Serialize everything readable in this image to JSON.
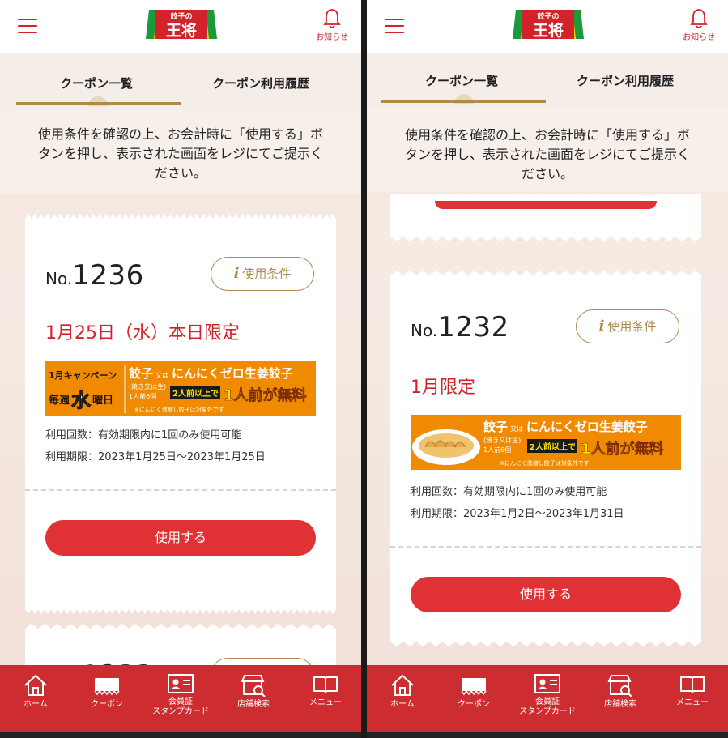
{
  "screens": [
    {
      "header": {
        "logo_top": "餃子の",
        "logo_main": "王将",
        "notify_label": "お知らせ"
      },
      "tabs": [
        {
          "label": "クーポン一覧"
        },
        {
          "label": "クーポン利用履歴"
        }
      ],
      "notice": [
        "使用条件を確認の上、お会計時に「使用する」ボ",
        "タンを押し、表示された画面をレジにてご提示く",
        "ださい。"
      ],
      "coupon": {
        "no_prefix": "No.",
        "number": "1236",
        "conditions_label": "使用条件",
        "deadline": "1月25日（水）本日限定",
        "banner": {
          "campaign": "1月キャンペーン",
          "weekly_pre": "毎週",
          "weekly_day": "水",
          "weekly_post": "曜日",
          "product_a": "餃子",
          "or_text": "又は",
          "product_b": "にんにくゼロ生姜餃子",
          "sub": "(焼き又は生)",
          "portion": "1人前6個",
          "condition": "2人前以上で",
          "free": "1人前が無料",
          "note": "※にんにく激増し餃子は対象外です"
        },
        "usage": "利用回数：有効期限内に1回のみ使用可能",
        "period": "利用期限：2023年1月25日〜2023年1月25日",
        "use_label": "使用する"
      },
      "next_coupon_number_partial": "1233",
      "footer": [
        {
          "label": "ホーム"
        },
        {
          "label": "クーポン"
        },
        {
          "label": "会員証\nスタンプカード"
        },
        {
          "label": "店舗検索"
        },
        {
          "label": "メニュー"
        }
      ]
    },
    {
      "header": {
        "logo_top": "餃子の",
        "logo_main": "王将",
        "notify_label": "お知らせ"
      },
      "tabs": [
        {
          "label": "クーポン一覧"
        },
        {
          "label": "クーポン利用履歴"
        }
      ],
      "notice": [
        "使用条件を確認の上、お会計時に「使用する」ボ",
        "タンを押し、表示された画面をレジにてご提示く",
        "ださい。"
      ],
      "coupon": {
        "no_prefix": "No.",
        "number": "1232",
        "conditions_label": "使用条件",
        "deadline": "1月限定",
        "banner": {
          "product_a": "餃子",
          "or_text": "又は",
          "product_b": "にんにくゼロ生姜餃子",
          "sub": "(焼き又は生)",
          "portion": "1人前6個",
          "condition": "2人前以上で",
          "free": "1人前が無料",
          "note": "※にんにく激増し餃子は対象外です"
        },
        "usage": "利用回数：有効期限内に1回のみ使用可能",
        "period": "利用期限：2023年1月2日〜2023年1月31日",
        "use_label": "使用する"
      },
      "footer": [
        {
          "label": "ホーム"
        },
        {
          "label": "クーポン"
        },
        {
          "label": "会員証\nスタンプカード"
        },
        {
          "label": "店舗検索"
        },
        {
          "label": "メニュー"
        }
      ]
    }
  ],
  "colors": {
    "brand_red": "#d2232a",
    "button_red": "#e03134",
    "footer_red": "#cd2c31",
    "gold": "#b08a4a",
    "banner_orange": "#f08a00"
  },
  "icons": [
    "menu-icon",
    "bell-icon",
    "info-icon",
    "home-icon",
    "coupon-icon",
    "member-card-icon",
    "store-search-icon",
    "menu-book-icon"
  ]
}
